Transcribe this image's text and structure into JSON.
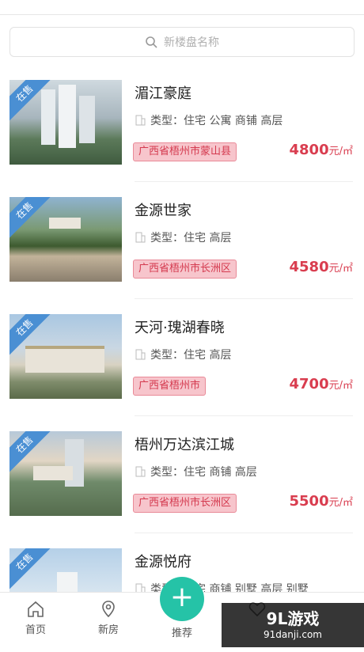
{
  "search": {
    "placeholder": "新楼盘名称"
  },
  "tags": {
    "sale": "在售"
  },
  "items": [
    {
      "title": "湄江豪庭",
      "type": "类型：住宅 公寓 商铺 高层",
      "location": "广西省梧州市蒙山县",
      "price": "4800",
      "unit": "元/㎡"
    },
    {
      "title": "金源世家",
      "type": "类型：住宅 高层",
      "location": "广西省梧州市长洲区",
      "price": "4580",
      "unit": "元/㎡"
    },
    {
      "title": "天河·瑰湖春晓",
      "type": "类型：住宅 高层",
      "location": "广西省梧州市",
      "price": "4700",
      "unit": "元/㎡"
    },
    {
      "title": "梧州万达滨江城",
      "type": "类型：住宅 商铺 高层",
      "location": "广西省梧州市长洲区",
      "price": "5500",
      "unit": "元/㎡"
    },
    {
      "title": "金源悦府",
      "type": "类型：住宅 商铺 别墅 高层 别墅",
      "location": "",
      "price": "",
      "unit": ""
    }
  ],
  "nav": {
    "home": "首页",
    "newhouse": "新房",
    "recommend": "推荐",
    "other": ""
  },
  "watermark": {
    "line1": "9L游戏",
    "line2": "91danji.com"
  }
}
